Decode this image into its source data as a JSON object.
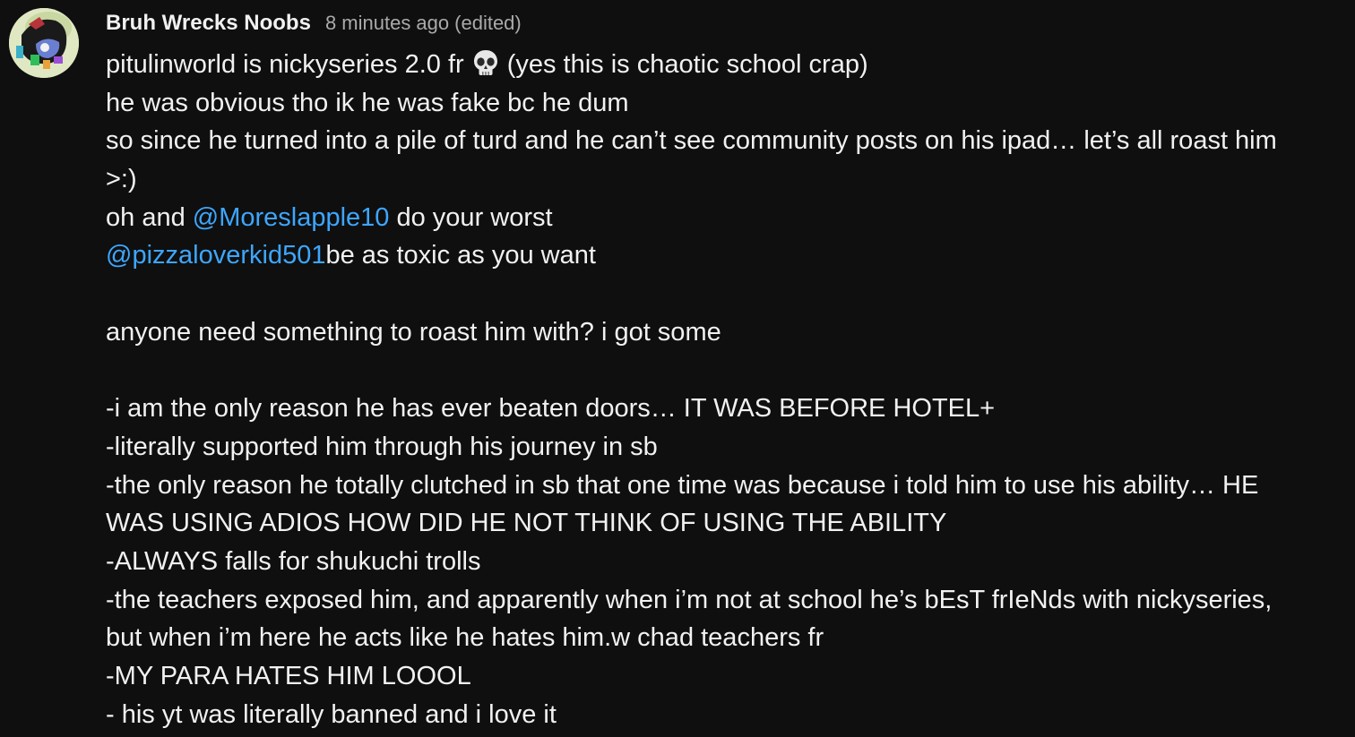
{
  "comment": {
    "author": "Bruh Wrecks Noobs",
    "timestamp": "8 minutes ago",
    "edited": "(edited)",
    "lines": {
      "l1a": "pitulinworld is nickyseries 2.0 fr",
      "l1b": "(yes this is chaotic school crap)",
      "l2": "he was obvious tho ik he was fake bc he dum",
      "l3": "so since he turned into a pile of turd and he can’t see community posts on his ipad… let’s all roast him",
      "l4": ">:)",
      "l5a": "oh and ",
      "l5mention": "@Moreslapple10",
      "l5b": " do your worst",
      "l6mention": "@pizzaloverkid501",
      "l6b": "be as toxic as you want",
      "l7": "anyone need something to roast him with? i got some",
      "l8": "-i am the only reason he has ever beaten doors… IT WAS BEFORE HOTEL+",
      "l9": "-literally supported him through his journey in sb",
      "l10": "-the only reason he totally clutched in sb that one time was because i told him to use his ability… HE",
      "l11": "WAS USING ADIOS HOW DID HE NOT THINK OF USING THE ABILITY",
      "l12": "-ALWAYS falls for shukuchi trolls",
      "l13": "-the teachers exposed him, and apparently when i’m not at school he’s bEsT frIeNds with nickyseries,",
      "l14": "but when i’m here he acts like he hates him.w chad teachers fr",
      "l15": "-MY PARA HATES HIM LOOOL",
      "l16": "- his yt was literally banned and i love it"
    },
    "emoji": "skull-emoji",
    "colors": {
      "background": "#0f0f0f",
      "text": "#f1f1f1",
      "muted": "#aaaaaa",
      "mention": "#3ea6ff"
    }
  }
}
